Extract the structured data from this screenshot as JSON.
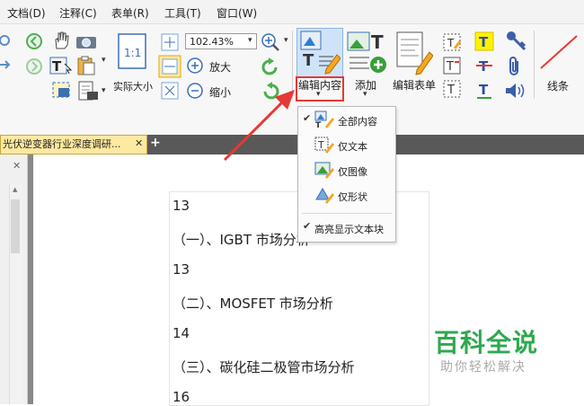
{
  "menu": {
    "items": [
      "文档(D)",
      "注释(C)",
      "表单(R)",
      "工具(T)",
      "窗口(W)"
    ]
  },
  "ribbon": {
    "actual_size_label": "实际大小",
    "zoom_value": "102.43%",
    "zoom_in_label": "放大",
    "zoom_out_label": "缩小",
    "edit_content_label": "编辑内容",
    "add_label": "添加",
    "edit_form_label": "编辑表单",
    "lines_label": "线条"
  },
  "tab": {
    "title": "光伏逆变器行业深度调研...",
    "close": "✕",
    "add": "+"
  },
  "dropdown": {
    "items": [
      {
        "label": "全部内容",
        "checked": true
      },
      {
        "label": "仅文本",
        "checked": false
      },
      {
        "label": "仅图像",
        "checked": false
      },
      {
        "label": "仅形状",
        "checked": false
      },
      {
        "label": "高亮显示文本块",
        "checked": true
      }
    ],
    "check_glyph": "✔"
  },
  "document": {
    "lines": [
      "13",
      "（一）、IGBT 市场分析",
      "13",
      "（二）、MOSFET 市场分析",
      "14",
      "（三）、碳化硅二极管市场分析",
      "16"
    ]
  },
  "watermark": {
    "title": "百科全说",
    "subtitle": "助你轻松解决"
  },
  "colors": {
    "accent_red": "#e53935",
    "highlight_blue": "#cfe3f8",
    "watermark_green": "#2fa84f"
  }
}
